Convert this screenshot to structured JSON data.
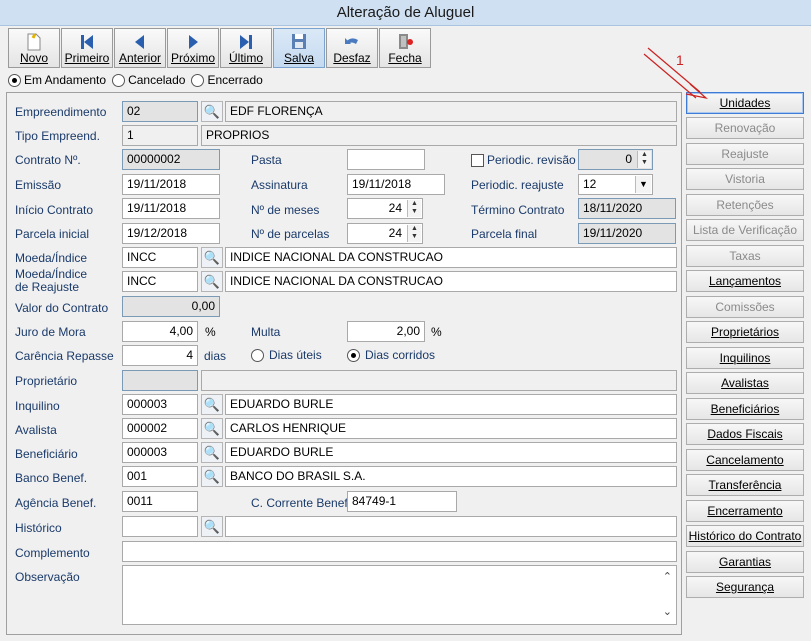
{
  "window": {
    "title": "Alteração de Aluguel"
  },
  "toolbar": {
    "novo": "Novo",
    "primeiro": "Primeiro",
    "anterior": "Anterior",
    "proximo": "Próximo",
    "ultimo": "Último",
    "salva": "Salva",
    "desfaz": "Desfaz",
    "fecha": "Fecha"
  },
  "status": {
    "em_andamento": "Em Andamento",
    "cancelado": "Cancelado",
    "encerrado": "Encerrado"
  },
  "form": {
    "empreendimento_label": "Empreendimento",
    "empreendimento_code": "02",
    "empreendimento_name": "EDF FLORENÇA",
    "tipo_label": "Tipo Empreend.",
    "tipo_code": "1",
    "tipo_name": "PROPRIOS",
    "contrato_label": "Contrato Nº.",
    "contrato_value": "00000002",
    "pasta_label": "Pasta",
    "pasta_value": "",
    "periodic_revisao_label": "Periodic. revisão",
    "periodic_revisao_value": "0",
    "emissao_label": "Emissão",
    "emissao_value": "19/11/2018",
    "assinatura_label": "Assinatura",
    "assinatura_value": "19/11/2018",
    "periodic_reajuste_label": "Periodic. reajuste",
    "periodic_reajuste_value": "12",
    "inicio_label": "Início Contrato",
    "inicio_value": "19/11/2018",
    "meses_label": "Nº de meses",
    "meses_value": "24",
    "termino_label": "Término Contrato",
    "termino_value": "18/11/2020",
    "parcela_inicial_label": "Parcela inicial",
    "parcela_inicial_value": "19/12/2018",
    "parcelas_label": "Nº de parcelas",
    "parcelas_value": "24",
    "parcela_final_label": "Parcela final",
    "parcela_final_value": "19/11/2020",
    "moeda_label": "Moeda/Índice",
    "moeda_code": "INCC",
    "moeda_name": "INDICE NACIONAL DA CONSTRUCAO",
    "moeda_reaj_label1": "Moeda/Índice",
    "moeda_reaj_label2": "de Reajuste",
    "moeda_reaj_code": "INCC",
    "moeda_reaj_name": "INDICE NACIONAL DA CONSTRUCAO",
    "valor_label": "Valor do Contrato",
    "valor_value": "0,00",
    "juro_label": "Juro de Mora",
    "juro_value": "4,00",
    "juro_unit": "%",
    "multa_label": "Multa",
    "multa_value": "2,00",
    "multa_unit": "%",
    "carencia_label": "Carência Repasse",
    "carencia_value": "4",
    "carencia_unit": "dias",
    "dias_uteis": "Dias úteis",
    "dias_corridos": "Dias corridos",
    "proprietario_label": "Proprietário",
    "inquilino_label": "Inquilino",
    "inquilino_code": "000003",
    "inquilino_name": "EDUARDO BURLE",
    "avalista_label": "Avalista",
    "avalista_code": "000002",
    "avalista_name": "CARLOS HENRIQUE",
    "beneficiario_label": "Beneficiário",
    "beneficiario_code": "000003",
    "beneficiario_name": "EDUARDO BURLE",
    "banco_label": "Banco Benef.",
    "banco_code": "001",
    "banco_name": "BANCO DO BRASIL S.A.",
    "agencia_label": "Agência Benef.",
    "agencia_value": "0011",
    "conta_label": "C. Corrente Benef.",
    "conta_value": "84749-1",
    "historico_label": "Histórico",
    "complemento_label": "Complemento",
    "observacao_label": "Observação"
  },
  "side": {
    "unidades": "Unidades",
    "renovacao": "Renovação",
    "reajuste": "Reajuste",
    "vistoria": "Vistoria",
    "retencoes": "Retenções",
    "lista": "Lista de Verificação",
    "taxas": "Taxas",
    "lancamentos": "Lançamentos",
    "comissoes": "Comissões",
    "proprietarios": "Proprietários",
    "inquilinos": "Inquilinos",
    "avalistas": "Avalistas",
    "beneficiarios": "Beneficiários",
    "dados_fiscais": "Dados Fiscais",
    "cancelamento": "Cancelamento",
    "transferencia": "Transferência",
    "encerramento": "Encerramento",
    "historico_contrato": "Histórico do Contrato",
    "garantias": "Garantias",
    "seguranca": "Segurança"
  },
  "annotation": {
    "marker": "1"
  },
  "colors": {
    "accent": "#3d7bd6",
    "title_bar": "#cfe0f2",
    "label_text": "#1a3a6a",
    "marker": "#cc2222"
  }
}
